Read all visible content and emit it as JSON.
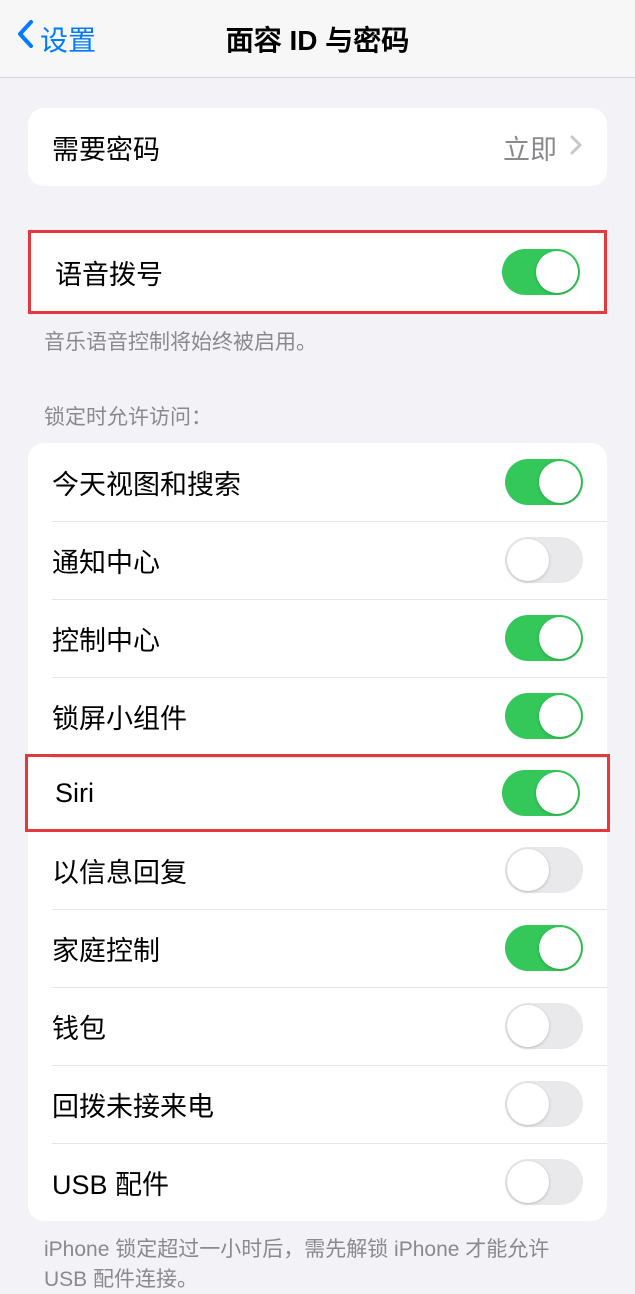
{
  "nav": {
    "back_label": "设置",
    "title": "面容 ID 与密码"
  },
  "passcode": {
    "require_label": "需要密码",
    "require_value": "立即"
  },
  "voice_dial": {
    "label": "语音拨号",
    "on": true,
    "footer": "音乐语音控制将始终被启用。"
  },
  "lock_access": {
    "header": "锁定时允许访问：",
    "items": [
      {
        "label": "今天视图和搜索",
        "on": true,
        "highlighted": false
      },
      {
        "label": "通知中心",
        "on": false,
        "highlighted": false
      },
      {
        "label": "控制中心",
        "on": true,
        "highlighted": false
      },
      {
        "label": "锁屏小组件",
        "on": true,
        "highlighted": false
      },
      {
        "label": "Siri",
        "on": true,
        "highlighted": true
      },
      {
        "label": "以信息回复",
        "on": false,
        "highlighted": false
      },
      {
        "label": "家庭控制",
        "on": true,
        "highlighted": false
      },
      {
        "label": "钱包",
        "on": false,
        "highlighted": false
      },
      {
        "label": "回拨未接来电",
        "on": false,
        "highlighted": false
      },
      {
        "label": "USB 配件",
        "on": false,
        "highlighted": false
      }
    ],
    "footer": "iPhone 锁定超过一小时后，需先解锁 iPhone 才能允许 USB 配件连接。"
  }
}
